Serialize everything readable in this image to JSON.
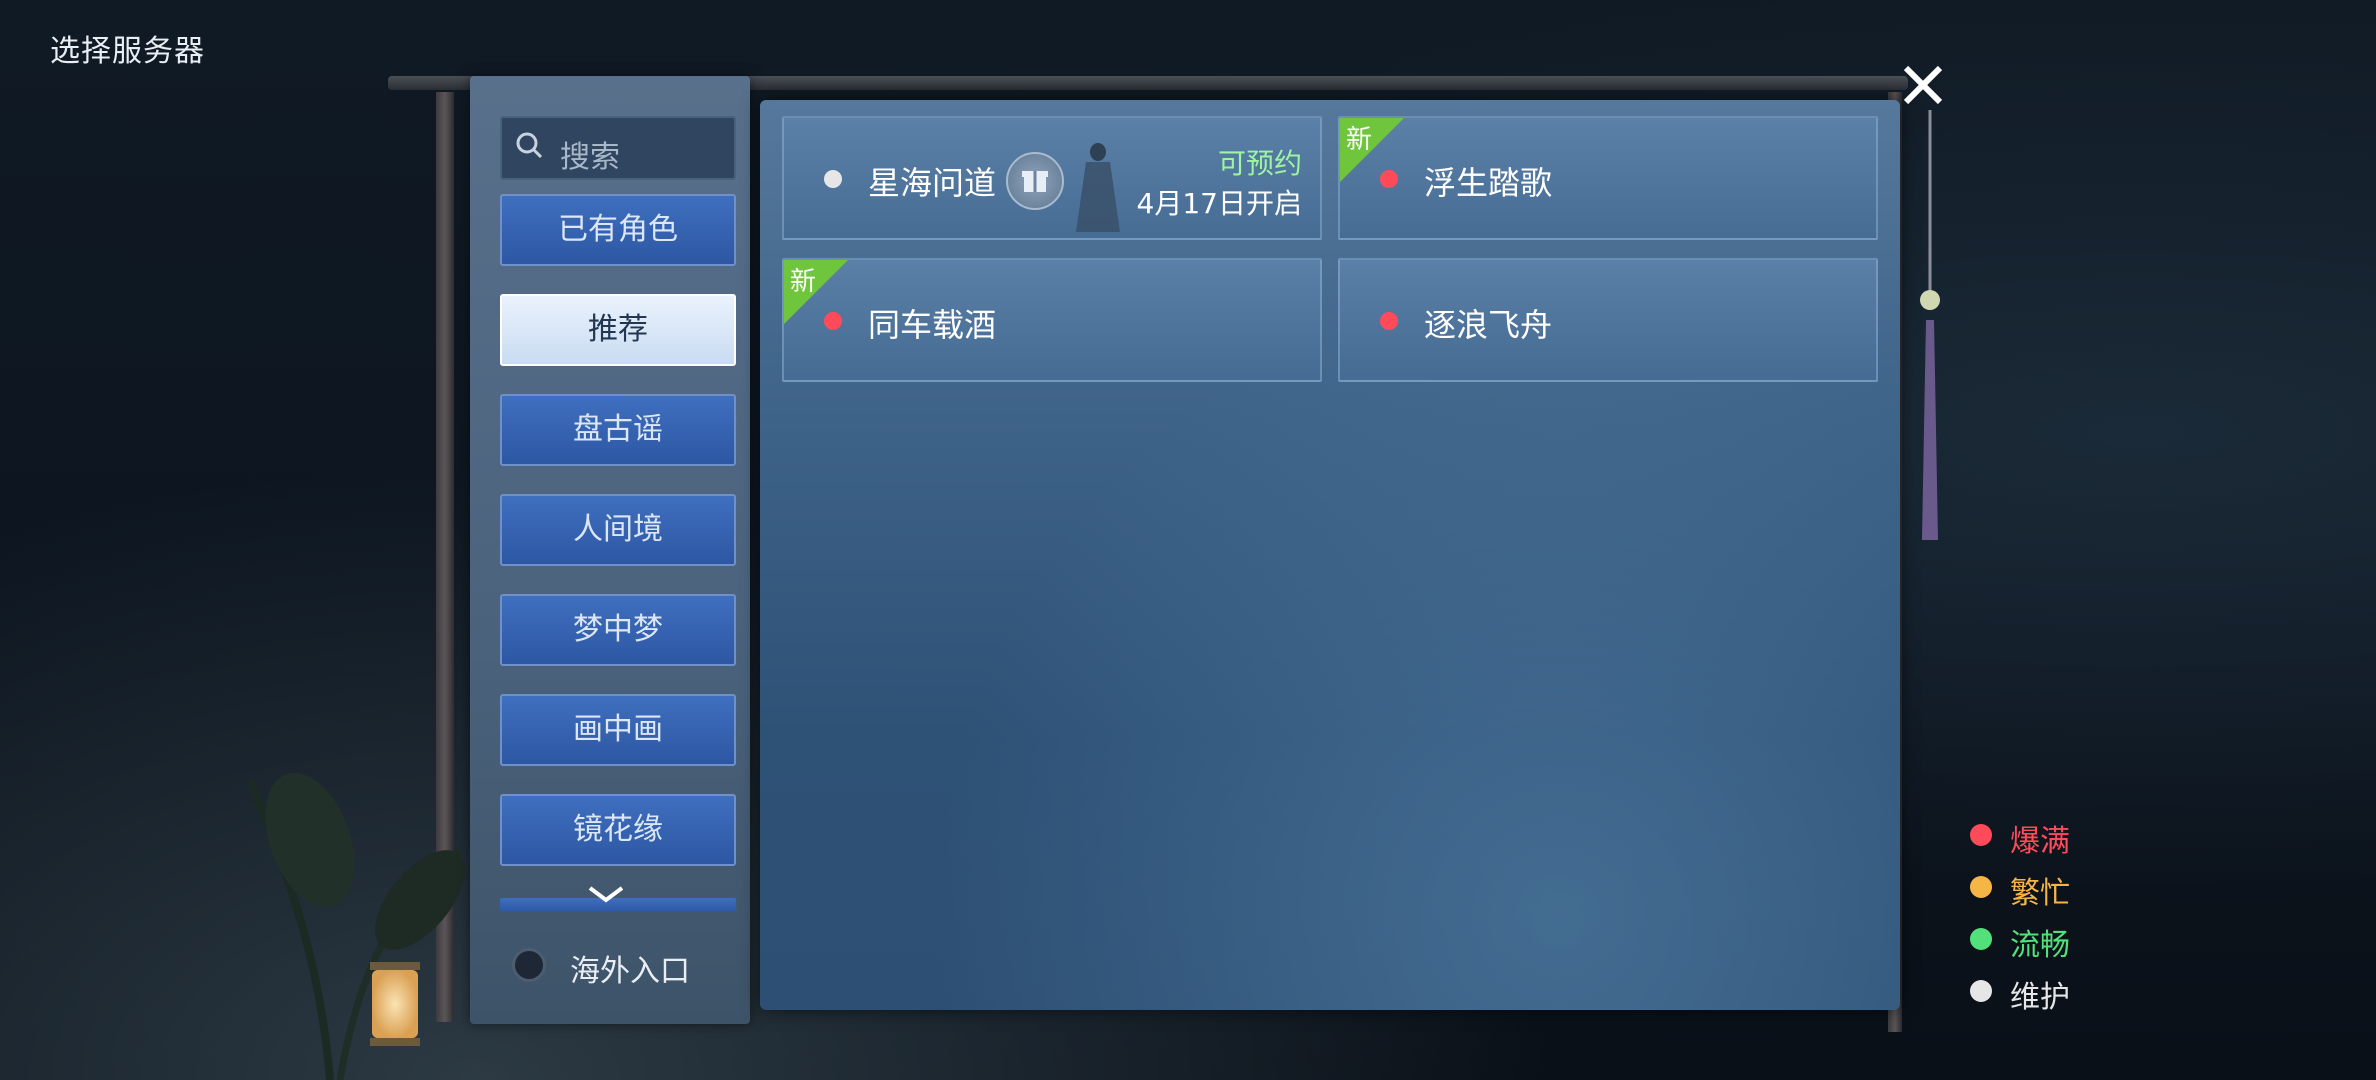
{
  "header": {
    "title": "选择服务器"
  },
  "search": {
    "placeholder": "搜索"
  },
  "tabs": [
    {
      "label": "已有角色",
      "active": false
    },
    {
      "label": "推荐",
      "active": true
    },
    {
      "label": "盘古谣",
      "active": false
    },
    {
      "label": "人间境",
      "active": false
    },
    {
      "label": "梦中梦",
      "active": false
    },
    {
      "label": "画中画",
      "active": false
    },
    {
      "label": "镜花缘",
      "active": false
    }
  ],
  "overseas": {
    "label": "海外入口"
  },
  "servers": [
    {
      "name": "星海问道",
      "status": "maintenance",
      "status_color": "#e6e6e6",
      "new": false,
      "has_gift": true,
      "reserve_label": "可预约",
      "open_date": "4月17日开启"
    },
    {
      "name": "浮生踏歌",
      "status": "full",
      "status_color": "#ff4a5a",
      "new": true,
      "badge": "新"
    },
    {
      "name": "同车载酒",
      "status": "full",
      "status_color": "#ff4a5a",
      "new": true,
      "badge": "新"
    },
    {
      "name": "逐浪飞舟",
      "status": "full",
      "status_color": "#ff4a5a",
      "new": false
    }
  ],
  "legend": [
    {
      "label": "爆满",
      "color": "#ff4a5a"
    },
    {
      "label": "繁忙",
      "color": "#f7b545"
    },
    {
      "label": "流畅",
      "color": "#52e07a"
    },
    {
      "label": "维护",
      "color": "#e6e6e6"
    }
  ],
  "icons": [
    "search-icon",
    "chevron-down-icon",
    "gift-icon",
    "close-icon"
  ]
}
